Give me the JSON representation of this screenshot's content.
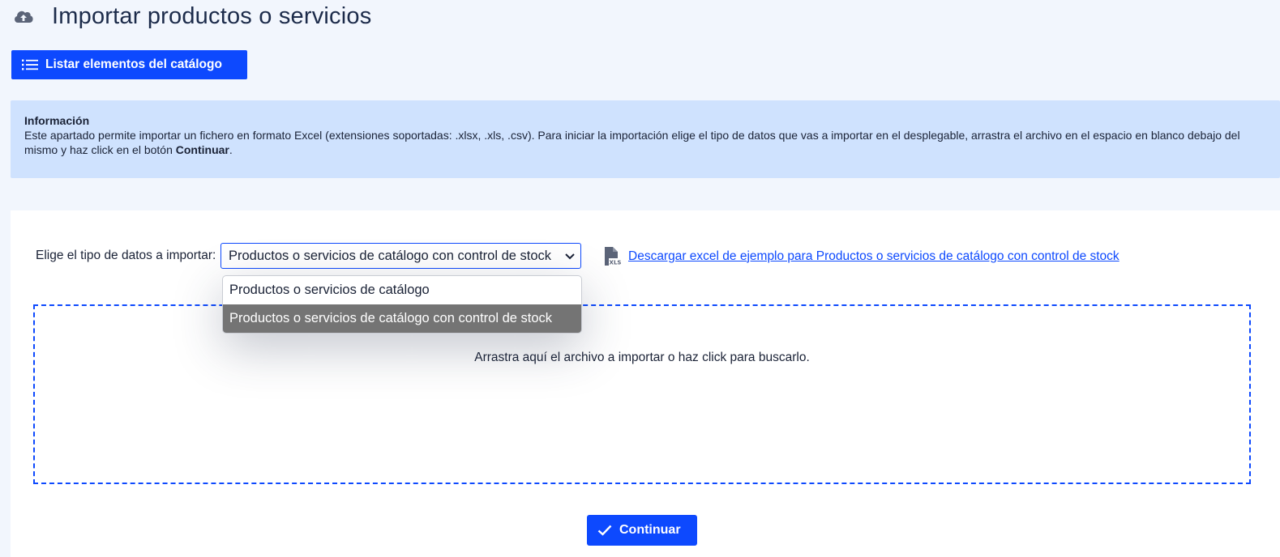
{
  "header": {
    "title": "Importar productos o servicios",
    "icon": "cloud-upload-icon"
  },
  "toolbar": {
    "list_label": "Listar elementos del catálogo",
    "list_icon": "list-icon"
  },
  "info": {
    "title": "Información",
    "text_before": "Este apartado permite importar un fichero en formato Excel (extensiones soportadas: .xlsx, .xls, .csv). Para iniciar la importación elige el tipo de datos que vas a importar en el desplegable, arrastra el archivo en el espacio en blanco debajo del mismo y haz click en el botón ",
    "text_bold": "Continuar",
    "text_after": "."
  },
  "form": {
    "type_label": "Elige el tipo de datos a importar:",
    "selected_value": "Productos o servicios de catálogo con control de stock",
    "options": [
      "Productos o servicios de catálogo",
      "Productos o servicios de catálogo con control de stock"
    ],
    "download_label": "Descargar excel de ejemplo para Productos o servicios de catálogo con control de stock",
    "download_icon": "xls-file-icon"
  },
  "dropzone": {
    "text": "Arrastra aquí el archivo a importar o haz click para buscarlo."
  },
  "actions": {
    "continue_label": "Continuar",
    "continue_icon": "check-icon"
  },
  "colors": {
    "primary": "#0d49fe",
    "info_bg": "#cfe2fe",
    "page_bg": "#f2f6fd",
    "selected_option": "#747474"
  }
}
